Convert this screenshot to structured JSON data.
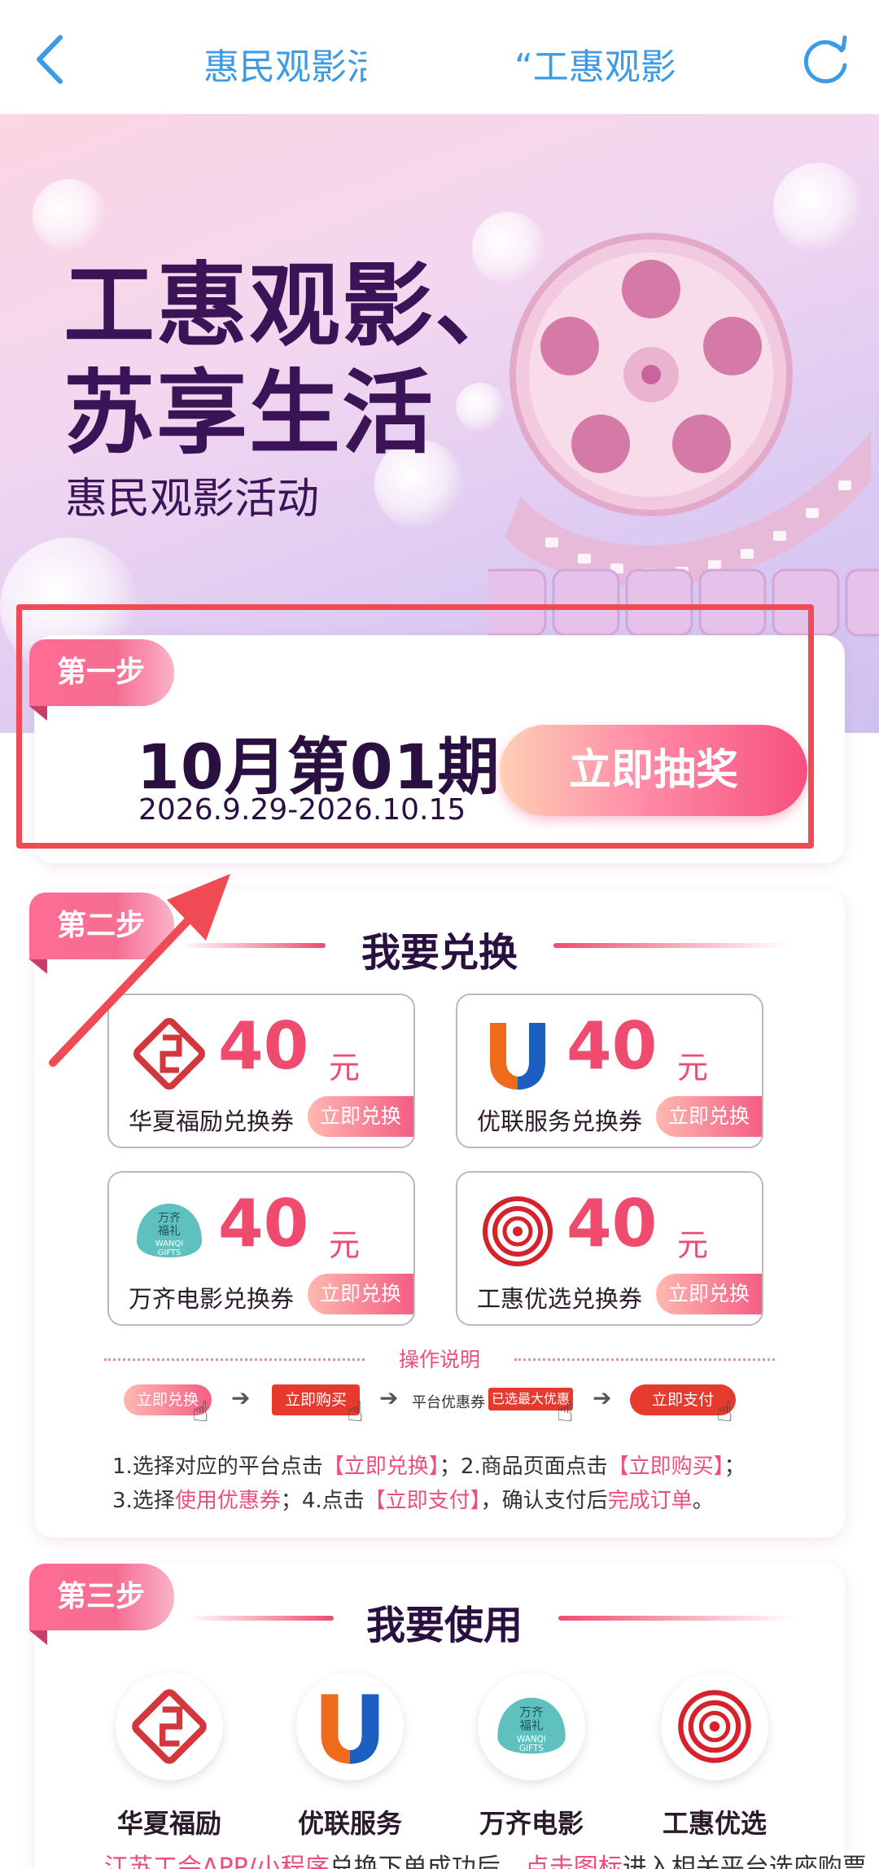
{
  "nav": {
    "title_left": "惠民观影活动",
    "title_right": "“工惠观影",
    "back_icon": "chevron-left-icon",
    "refresh_icon": "refresh-icon"
  },
  "banner": {
    "title_line1": "工惠观影、",
    "title_line2": "苏享生活",
    "subtitle": "惠民观影活动"
  },
  "step1": {
    "tag": "第一步",
    "period": "10月第01期",
    "dates": "2026.9.29-2026.10.15",
    "action": "立即抽奖"
  },
  "step2": {
    "tag": "第二步",
    "heading": "我要兑换",
    "coupons": [
      {
        "amount": "40",
        "unit": "元",
        "name": "华夏福励兑换券",
        "action": "立即兑换",
        "icon": "huaxia-logo-icon"
      },
      {
        "amount": "40",
        "unit": "元",
        "name": "优联服务兑换券",
        "action": "立即兑换",
        "icon": "youlian-logo-icon"
      },
      {
        "amount": "40",
        "unit": "元",
        "name": "万齐电影兑换券",
        "action": "立即兑换",
        "icon": "wanqi-logo-icon"
      },
      {
        "amount": "40",
        "unit": "元",
        "name": "工惠优选兑换券",
        "action": "立即兑换",
        "icon": "gonghui-logo-icon"
      }
    ],
    "op_title": "操作说明",
    "flow": {
      "s1": "立即兑换",
      "s2": "立即购买",
      "s3_label": "平台优惠券",
      "s3_tag": "已选最大优惠",
      "s4": "立即支付"
    },
    "instructions": {
      "p1": "1.选择对应的平台点击",
      "h1": "【立即兑换】",
      "p2": "；2.商品页面点击",
      "h2": "【立即购买】",
      "p3": "；",
      "p4": "3.选择",
      "h3": "使用优惠券",
      "p5": "；4.点击",
      "h4": "【立即支付】",
      "p6": "，确认支付后",
      "h5": "完成订单",
      "p7": "。"
    }
  },
  "step3": {
    "tag": "第三步",
    "heading": "我要使用",
    "apps": [
      {
        "name": "华夏福励",
        "icon": "huaxia-logo-icon"
      },
      {
        "name": "优联服务",
        "icon": "youlian-logo-icon"
      },
      {
        "name": "万齐电影",
        "icon": "wanqi-logo-icon"
      },
      {
        "name": "工惠优选",
        "icon": "gonghui-logo-icon"
      }
    ],
    "note": {
      "h1": "江苏工会APP/小程序",
      "p1": "兑换下单成功后，",
      "h2": "点击图标",
      "p2": "进入相关平台选座购票"
    }
  },
  "wanqi_logo_text": [
    "万齐",
    "福礼",
    "WANQI",
    "GIFTS"
  ],
  "colors": {
    "accent_pink": "#ef4b6e",
    "nav_blue": "#3d9be6",
    "highlight_red": "#f04a55",
    "dark_purple": "#2a1040"
  }
}
